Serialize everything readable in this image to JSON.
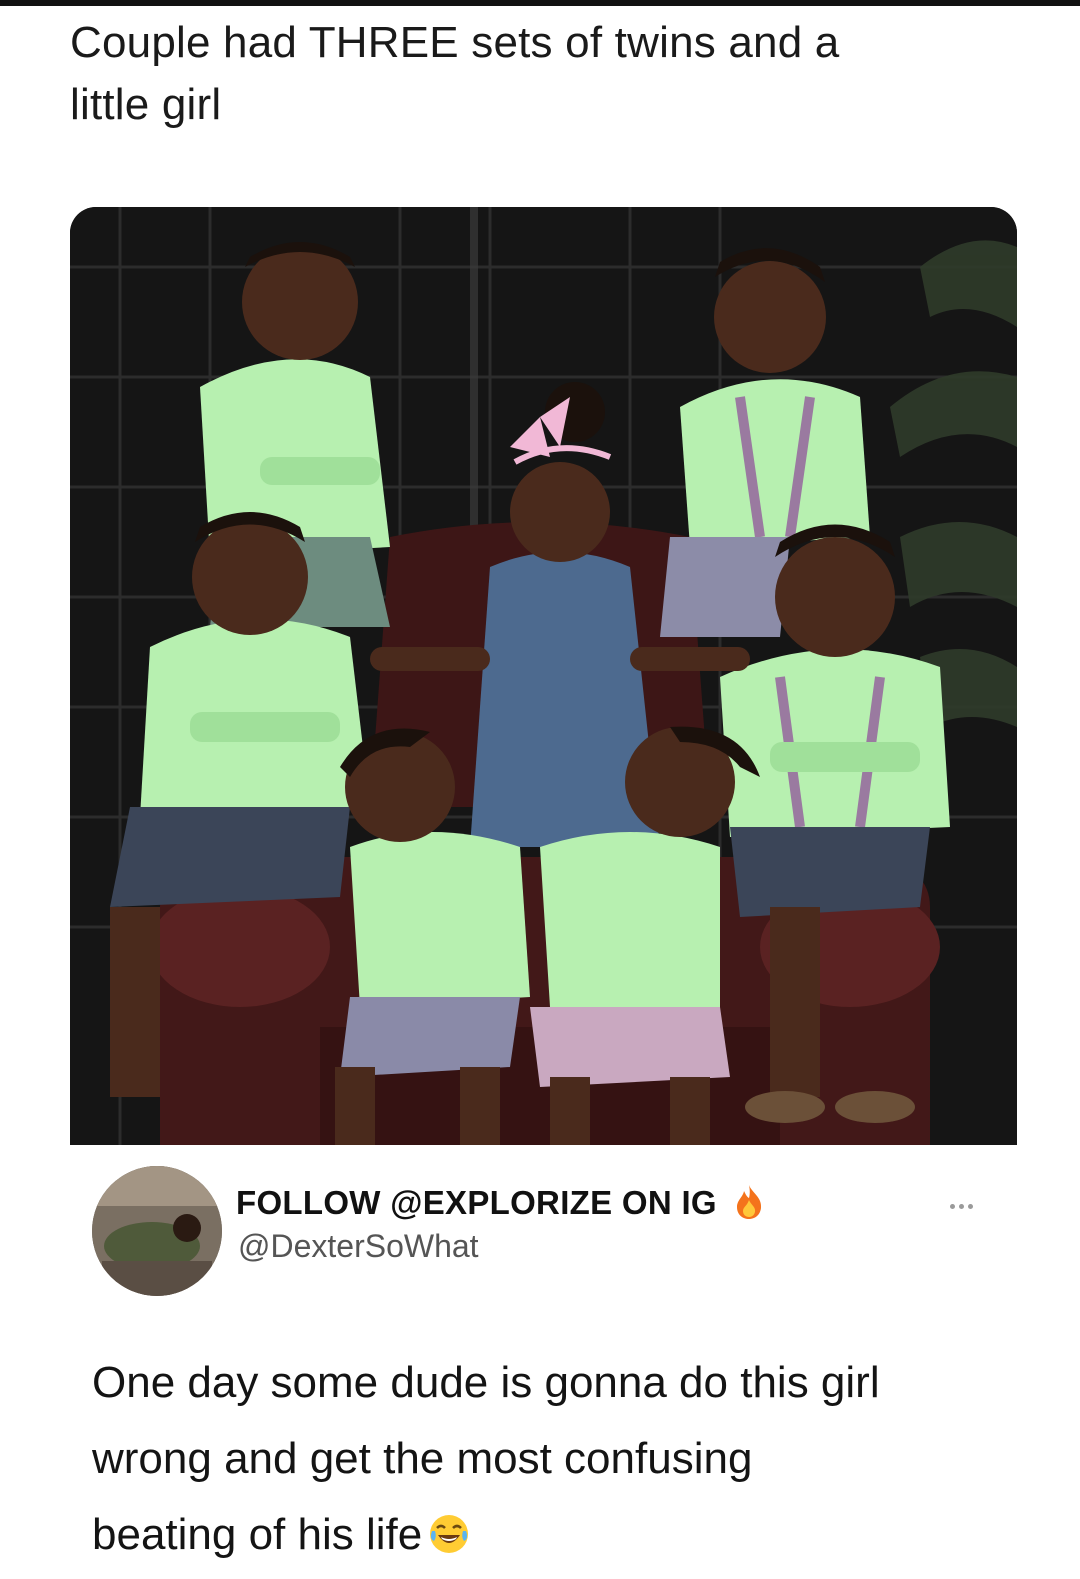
{
  "caption": {
    "line1": "Couple had THREE sets of twins and a",
    "line2": "little girl"
  },
  "photo": {
    "icon": "family-photo-seven-children"
  },
  "post": {
    "display_name": "FOLLOW @EXPLORIZE ON IG",
    "handle": "@DexterSoWhat",
    "badge_icon": "fire-emoji",
    "more_icon": "more-options-icon",
    "text_lines": [
      "One day some dude is gonna do this girl",
      "wrong and get the most confusing",
      "beating of his life"
    ],
    "trailing_emoji": "laughing-tears-emoji"
  },
  "colors": {
    "shirt_green": "#b7f0b0",
    "background_dark": "#141414",
    "chair_leather": "#4a1c1c",
    "dress_denim": "#4d6a8f",
    "bow_pink": "#f1b8d6"
  }
}
